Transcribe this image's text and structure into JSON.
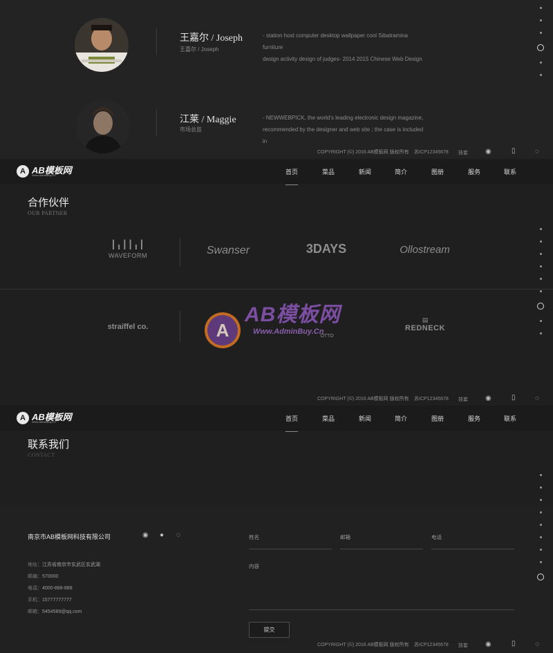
{
  "team": {
    "members": [
      {
        "name": "王嘉尔 / Joseph",
        "role": "王嘉尔 / Joseph",
        "desc_1": "- station host computer desktop wallpaper cool Sibatramina furniture",
        "desc_2": "design activity design of judges- 2014 2015 Chinese Web Design"
      },
      {
        "name": "江莱 / Maggie",
        "role": "市场总监",
        "desc_1": "- NEWWEBPICK, the world's leading electronic design magazine,",
        "desc_2": "recommended by the designer and web site ; the case is included in"
      }
    ]
  },
  "copyright": {
    "text": "COPYRIGHT (©) 2016 AB模板网 版权所有",
    "icp": "苏ICP12345678",
    "extra": "技套"
  },
  "icons": {
    "weibo": "weibo-icon",
    "mobile": "mobile-icon",
    "wechat": "wechat-icon",
    "qq": "qq-icon"
  },
  "logo": {
    "text": "AB模板网",
    "letter": "A",
    "sub": "Www.AdminBuy.Cn"
  },
  "nav": {
    "items": [
      "首页",
      "菜品",
      "新闻",
      "简介",
      "图册",
      "服务",
      "联系"
    ],
    "active": 0
  },
  "partner": {
    "title": "合作伙伴",
    "subtitle": "OUR PARTNER",
    "row1": [
      "WAVEFORM",
      "Swanser",
      "3DAYS",
      "Ollostream"
    ],
    "row2": [
      "straiffel co.",
      "OTTO",
      "REDNECK"
    ]
  },
  "watermark": {
    "text": "AB模板网",
    "url": "Www.AdminBuy.Cn"
  },
  "contact": {
    "title": "联系我们",
    "subtitle": "CONTACT",
    "company": "南京市AB模板网科技有限公司",
    "info": [
      {
        "label": "地址：",
        "value": "江苏省南京市玄武区玄武湖"
      },
      {
        "label": "邮编：",
        "value": "570000"
      },
      {
        "label": "电话：",
        "value": "4000-888-888"
      },
      {
        "label": "手机：",
        "value": "15777777777"
      },
      {
        "label": "邮箱：",
        "value": "5454589@qq.com"
      }
    ],
    "form": {
      "name": "姓名",
      "email": "邮箱",
      "phone": "电话",
      "content": "内容",
      "submit": "提交"
    }
  },
  "colors": {
    "background": "#1f1f20",
    "nav": "#1b1b1c",
    "accent": "#e07a22",
    "watermark_purple": "#7a4fa0"
  }
}
